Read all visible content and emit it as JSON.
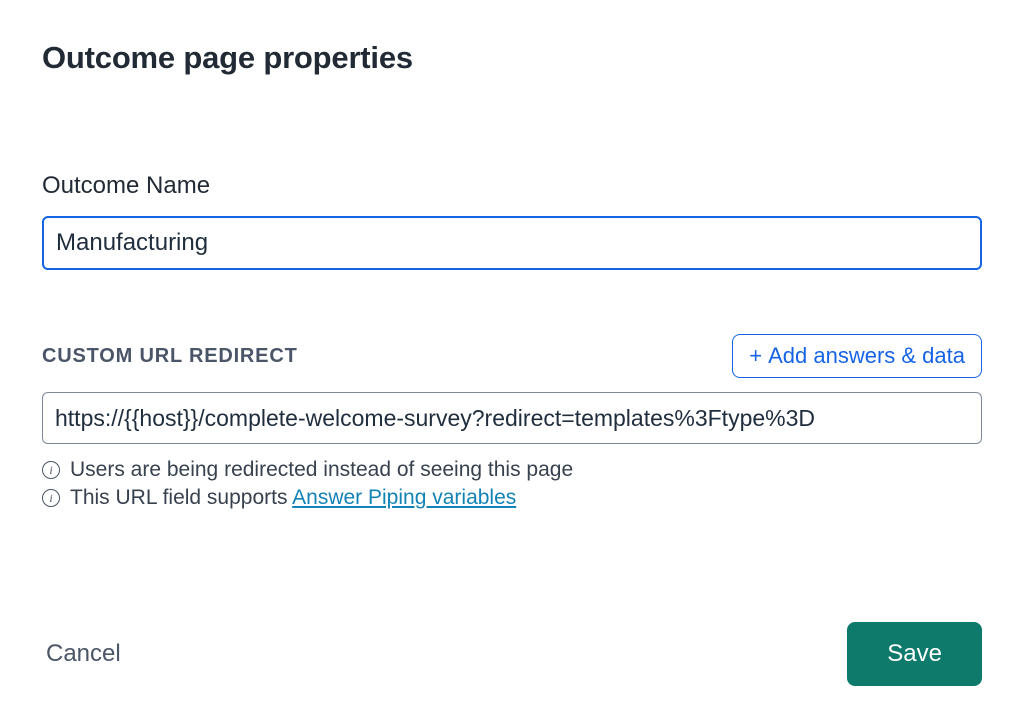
{
  "header": {
    "title": "Outcome page properties"
  },
  "outcome_name": {
    "label": "Outcome Name",
    "value": "Manufacturing"
  },
  "custom_url": {
    "section_label": "CUSTOM URL REDIRECT",
    "add_button_label": "Add answers & data",
    "value": "https://{{host}}/complete-welcome-survey?redirect=templates%3Ftype%3D",
    "hint1": "Users are being redirected instead of seeing this page",
    "hint2_prefix": "This URL field supports ",
    "hint2_link": "Answer Piping variables"
  },
  "footer": {
    "cancel_label": "Cancel",
    "save_label": "Save"
  }
}
